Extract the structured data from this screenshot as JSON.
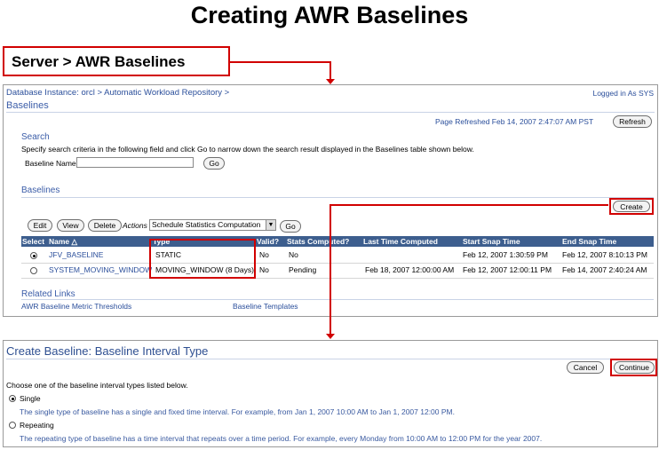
{
  "slide_title": "Creating AWR Baselines",
  "callout": "Server > AWR Baselines",
  "page1": {
    "breadcrumb": {
      "db_instance": "Database Instance: orcl",
      "sep": ">",
      "awr": "Automatic Workload Repository",
      "sep2": ">"
    },
    "logged_in": "Logged in As SYS",
    "page_title": "Baselines",
    "refreshed": "Page Refreshed Feb 14, 2007 2:47:07 AM PST",
    "refresh_btn": "Refresh",
    "search": {
      "heading": "Search",
      "hint": "Specify search criteria in the following field and click Go to narrow down the search result displayed in the Baselines table shown below.",
      "label": "Baseline Name",
      "value": "",
      "go": "Go"
    },
    "baselines_heading": "Baselines",
    "create_btn": "Create",
    "toolbar": {
      "edit": "Edit",
      "view": "View",
      "delete": "Delete",
      "actions_label": "Actions",
      "actions_value": "Schedule Statistics Computation",
      "go": "Go"
    },
    "table": {
      "headers": [
        "Select",
        "Name △",
        "Type",
        "Valid?",
        "Stats Computed?",
        "Last Time Computed",
        "Start Snap Time",
        "End Snap Time"
      ],
      "rows": [
        {
          "selected": true,
          "name": "JFV_BASELINE",
          "type": "STATIC",
          "valid": "No",
          "stats": "No",
          "last": "",
          "start": "Feb 12, 2007 1:30:59 PM",
          "end": "Feb 12, 2007 8:10:13 PM"
        },
        {
          "selected": false,
          "name": "SYSTEM_MOVING_WINDOW",
          "type": "MOVING_WINDOW (8 Days)",
          "valid": "No",
          "stats": "Pending",
          "last": "Feb 18, 2007 12:00:00 AM",
          "start": "Feb 12, 2007 12:00:11 PM",
          "end": "Feb 14, 2007 2:40:24 AM"
        }
      ]
    },
    "related": {
      "heading": "Related Links",
      "link1": "AWR Baseline Metric Thresholds",
      "link2": "Baseline Templates"
    }
  },
  "page2": {
    "title": "Create Baseline: Baseline Interval Type",
    "cancel": "Cancel",
    "continue": "Continue",
    "instruction": "Choose one of the baseline interval types listed below.",
    "options": [
      {
        "label": "Single",
        "selected": true,
        "desc": "The single type of baseline has a single and fixed time interval. For example, from Jan 1, 2007 10:00 AM to Jan 1, 2007 12:00 PM."
      },
      {
        "label": "Repeating",
        "selected": false,
        "desc": "The repeating type of baseline has a time interval that repeats over a time period. For example, every Monday from 10:00 AM to 12:00 PM for the year 2007."
      }
    ]
  },
  "colors": {
    "accent_red": "#d10000",
    "link_blue": "#2b4f9b",
    "table_header": "#3d5e8e"
  }
}
